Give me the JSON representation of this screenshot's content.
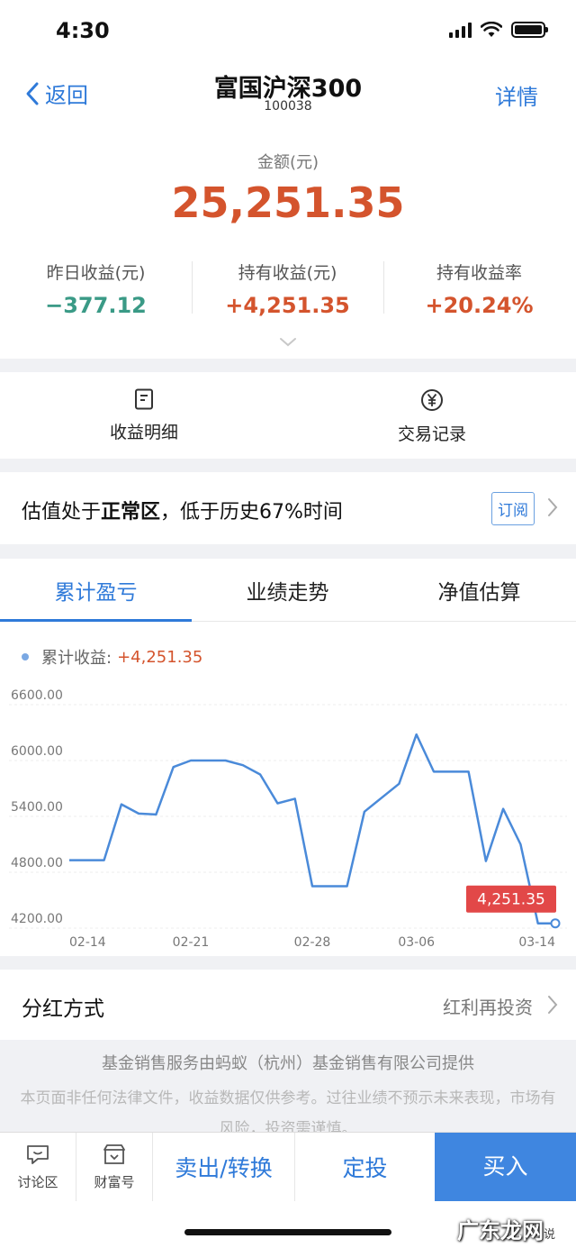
{
  "status": {
    "time": "4:30"
  },
  "nav": {
    "back_label": "返回",
    "title": "富国沪深300",
    "code": "100038",
    "detail_label": "详情"
  },
  "summary": {
    "amount_label": "金额(元)",
    "amount_value": "25,251.35",
    "stats": [
      {
        "label": "昨日收益(元)",
        "value": "−377.12",
        "color": "#3a9a86"
      },
      {
        "label": "持有收益(元)",
        "value": "+4,251.35",
        "color": "#d4542d"
      },
      {
        "label": "持有收益率",
        "value": "+20.24%",
        "color": "#d4542d"
      }
    ]
  },
  "actions": [
    {
      "label": "收益明细",
      "icon": "document-icon"
    },
    {
      "label": "交易记录",
      "icon": "yen-circle-icon"
    }
  ],
  "valuation": {
    "prefix": "估值处于",
    "highlight": "正常区",
    "suffix": "，低于历史67%时间",
    "subscribe_label": "订阅"
  },
  "tabs": [
    "累计盈亏",
    "业绩走势",
    "净值估算"
  ],
  "legend": {
    "label": "累计收益:",
    "value": "+4,251.35"
  },
  "chart_data": {
    "type": "line",
    "series": [
      {
        "name": "累计收益",
        "color": "#4a8ad9",
        "x": [
          "02-14",
          "02-15",
          "02-16",
          "02-17",
          "02-18",
          "02-19",
          "02-20",
          "02-21",
          "02-22",
          "02-23",
          "02-24",
          "02-25",
          "02-26",
          "02-27",
          "02-28",
          "03-01",
          "03-02",
          "03-03",
          "03-04",
          "03-05",
          "03-06",
          "03-07",
          "03-08",
          "03-09",
          "03-10",
          "03-11",
          "03-12",
          "03-13",
          "03-14"
        ],
        "values": [
          4930,
          4930,
          4930,
          5530,
          5430,
          5420,
          5930,
          6000,
          6000,
          6000,
          5950,
          5850,
          5540,
          5590,
          4650,
          4650,
          4650,
          5450,
          5600,
          5750,
          6280,
          5880,
          5880,
          5880,
          4920,
          5480,
          5100,
          4251.35,
          4251.35
        ]
      }
    ],
    "x_ticks": [
      "02-14",
      "02-21",
      "02-28",
      "03-06",
      "03-14"
    ],
    "y_ticks": [
      "6600.00",
      "6000.00",
      "5400.00",
      "4800.00",
      "4200.00"
    ],
    "ylim": [
      4200,
      6600
    ],
    "last_label": "4,251.35",
    "grid": true
  },
  "dividend": {
    "label": "分红方式",
    "value": "红利再投资"
  },
  "disclaimer": {
    "line1": "基金销售服务由蚂蚁（杭州）基金销售有限公司提供",
    "line2": "本页面非任何法律文件，收益数据仅供参考。过往业绩不预示未来表现，市场有风险，投资需谨慎。"
  },
  "bottom": {
    "forum_label": "讨论区",
    "wealth_label": "财富号",
    "sell_label": "卖出/转换",
    "fixed_label": "定投",
    "buy_label": "买入"
  },
  "watermark": {
    "text": "广东龙网",
    "small": "说"
  }
}
